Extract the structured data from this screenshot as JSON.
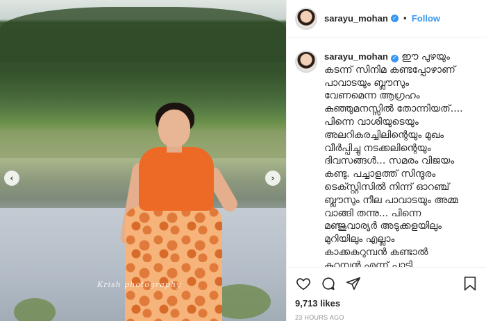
{
  "post": {
    "username": "sarayu_mohan",
    "verified_icon": "verified-badge-icon",
    "follow_dot": "•",
    "follow_label": "Follow",
    "watermark": "Krish photography",
    "nav": {
      "prev": "‹",
      "next": "›"
    },
    "caption_text": "ഈ പുഴയും\nകടന്ന് സിനിമ കണ്ടപ്പോഴാണ്\nപാവാടയും ബ്ലൗസും\nവേണമെന്ന ആഗ്രഹം\nകുഞ്ഞുമനസ്സിൽ തോന്നിയത്....\nപിന്നെ വാശിയുടെയും\nഅലറികരച്ചിലിന്റെയും മുഖം\nവീർപ്പിച്ചു നടക്കലിന്റെയും\nദിവസങ്ങൾ... സമരം വിജയം\nകണ്ടു. പച്ചാളത്ത് സിന്ദൂരം\nടെക്സ്റ്റിസിൽ നിന്ന് ഓറഞ്ച്\nബ്ലൗസും നീല പാവാടയും അമ്മ\nവാങ്ങി തന്നു... പിന്നെ\nമഞ്ജുവാര്യർ അടുക്കളയിലും\nമുറിയിലും എല്ലാം\nകാക്കകറുമ്പൻ കണ്ടാൽ\nകുറുമ്പൻ എന്ന് പാടി\nനടപ്പായി...സ്കൂളിൽ അതാട്ട്\nപാട്ടുപാടി (അന്ന് ഞാൻ\nഅഞ്ചാം ക്ലാസ്സിൽ... അന്നിയത്തെ",
    "likes": "9,713 likes",
    "timestamp": "23 HOURS AGO",
    "icons": {
      "like": "heart-icon",
      "comment": "comment-icon",
      "share": "share-icon",
      "save": "bookmark-icon"
    },
    "colors": {
      "accent": "#3897f0",
      "blouse": "#ec6a25",
      "skirt": "#f6b37a"
    }
  }
}
